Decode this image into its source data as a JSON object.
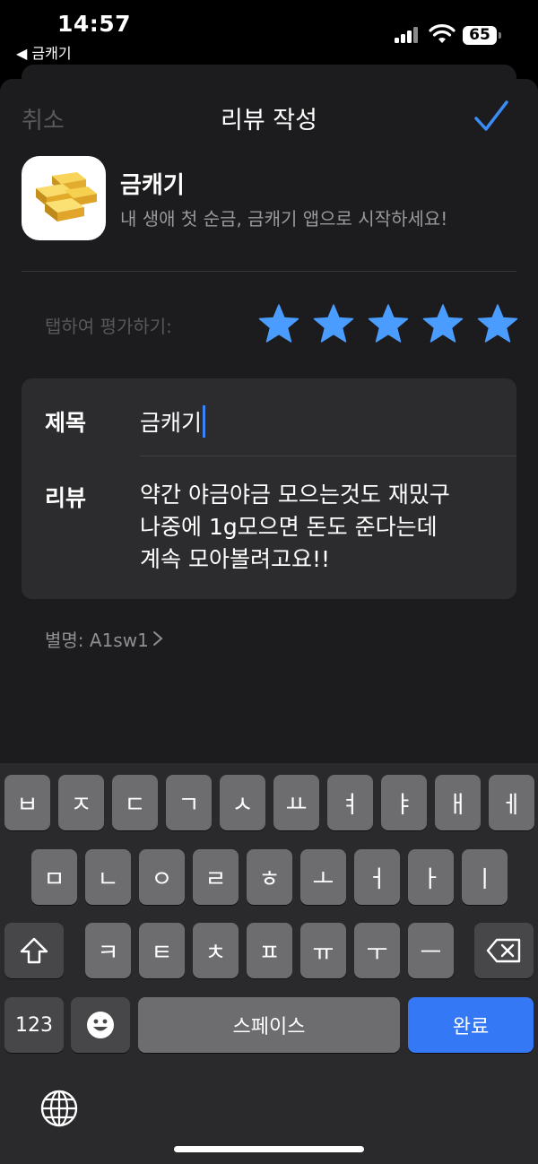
{
  "status_bar": {
    "time": "14:57",
    "back_app": "◀ 금캐기",
    "battery": "65"
  },
  "nav": {
    "cancel": "취소",
    "title": "리뷰 작성",
    "submit_icon": "checkmark-icon"
  },
  "app": {
    "name": "금캐기",
    "subtitle": "내 생애 첫 순금, 금캐기 앱으로 시작하세요!",
    "icon": "gold-bars-icon"
  },
  "rating": {
    "label": "탭하여 평가하기:",
    "stars_filled": 5,
    "stars_total": 5,
    "star_color": "#4a9dff"
  },
  "form": {
    "title_label": "제목",
    "title_value": "금캐기",
    "review_label": "리뷰",
    "review_value": "약간 야금야금 모으는것도 재밌구\n나중에 1g모으면 돈도 준다는데\n계속 모아볼려고요!!"
  },
  "nickname": {
    "text": "별명: A1sw1"
  },
  "keyboard": {
    "row1": [
      "ㅂ",
      "ㅈ",
      "ㄷ",
      "ㄱ",
      "ㅅ",
      "ㅛ",
      "ㅕ",
      "ㅑ",
      "ㅐ",
      "ㅔ"
    ],
    "row2": [
      "ㅁ",
      "ㄴ",
      "ㅇ",
      "ㄹ",
      "ㅎ",
      "ㅗ",
      "ㅓ",
      "ㅏ",
      "ㅣ"
    ],
    "row3": [
      "ㅋ",
      "ㅌ",
      "ㅊ",
      "ㅍ",
      "ㅠ",
      "ㅜ",
      "ㅡ"
    ],
    "numbers": "123",
    "space": "스페이스",
    "done": "완료",
    "accent": "#3478f6"
  }
}
